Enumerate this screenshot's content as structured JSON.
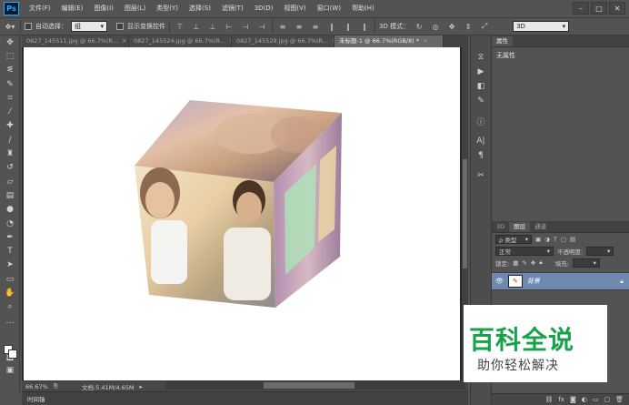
{
  "app": {
    "logo": "Ps"
  },
  "menu": [
    "文件(F)",
    "编辑(E)",
    "图像(I)",
    "图层(L)",
    "类型(Y)",
    "选择(S)",
    "滤镜(T)",
    "3D(D)",
    "视图(V)",
    "窗口(W)",
    "帮助(H)"
  ],
  "options": {
    "auto_select_label": "自动选择：",
    "auto_select_value": "组",
    "show_transform_label": "显示变换控件",
    "mode_3d_label": "3D 模式：",
    "workspace_value": "3D"
  },
  "tabs": [
    {
      "label": "0827_145511.jpg @ 66.7%(R..."
    },
    {
      "label": "0827_145524.jpg @ 66.7%(R..."
    },
    {
      "label": "0827_145529.jpg @ 66.7%(R..."
    },
    {
      "label": "未标题-1 @ 66.7%(RGB/8) *"
    }
  ],
  "status": {
    "zoom": "66.67%",
    "doc": "文档:5.41M/4.65M"
  },
  "timeline": {
    "label": "时间轴"
  },
  "properties": {
    "tab": "属性",
    "no_props": "无属性"
  },
  "layers": {
    "tabs": [
      "3D",
      "图层",
      "通道"
    ],
    "filter_label": "ρ 类型",
    "blend_mode": "正常",
    "opacity_label": "不透明度:",
    "lock_label": "锁定:",
    "fill_label": "填充:",
    "layer_name": "背景"
  },
  "watermark": {
    "main": "百科全说",
    "sub": "助你轻松解决"
  },
  "colors": {
    "chrome": "#535353",
    "selected_layer": "#6f88b0",
    "watermark_green": "#16a34a"
  }
}
